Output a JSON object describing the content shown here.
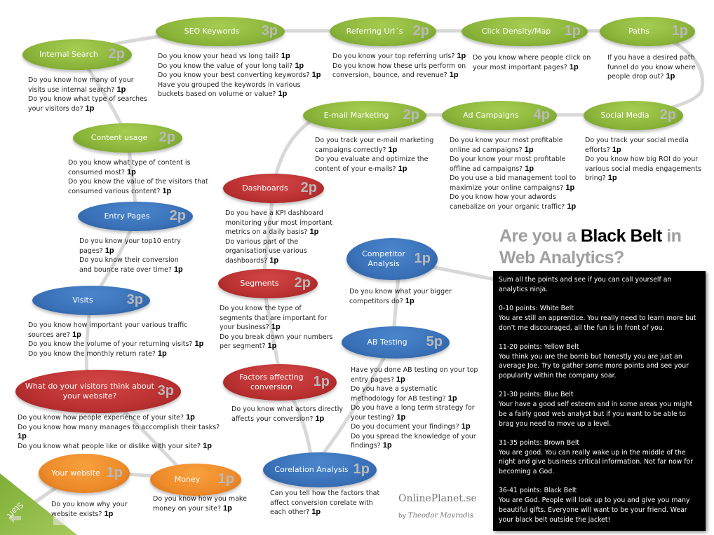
{
  "title": {
    "pre": "Are you a ",
    "highlight": "Black Belt",
    "post": " in",
    "line2": "Web Analytics?"
  },
  "nodes": [
    {
      "id": "internal-search",
      "label": "Internal Search",
      "points": "2p",
      "color": "green",
      "questions": [
        {
          "text": "Do you know how many of your visits use internal search?",
          "points": "1p"
        },
        {
          "text": "Do you know what type of searches your visitors do?",
          "points": "1p"
        }
      ]
    },
    {
      "id": "seo-keywords",
      "label": "SEO Keywords",
      "points": "3p",
      "color": "green",
      "questions": [
        {
          "text": "Do you know your head vs long tail?",
          "points": "1p"
        },
        {
          "text": "Do you know the value of your long tail?",
          "points": "1p"
        },
        {
          "text": "Do you know your best converting keywords?",
          "points": "1p"
        },
        {
          "text": "Have you grouped the keywords in various buckets based on volume or value?",
          "points": "1p"
        }
      ]
    },
    {
      "id": "referring-urls",
      "label": "Referring Url´s",
      "points": "2p",
      "color": "green",
      "questions": [
        {
          "text": "Do you know your top referring urls?",
          "points": "1p"
        },
        {
          "text": "Do you know how these urls perform on conversion, bounce, and revenue?",
          "points": "1p"
        }
      ]
    },
    {
      "id": "click-density",
      "label": "Click Density/Map",
      "points": "1p",
      "color": "green",
      "questions": [
        {
          "text": "Do you know where people click on your most important pages?",
          "points": "1p"
        }
      ]
    },
    {
      "id": "paths",
      "label": "Paths",
      "points": "1p",
      "color": "green",
      "questions": [
        {
          "text": "If you have a desired path funnel do you know where people drop out?",
          "points": "1p"
        }
      ]
    },
    {
      "id": "email-marketing",
      "label": "E-mail Marketing",
      "points": "2p",
      "color": "green",
      "questions": [
        {
          "text": "Do you track your e-mail marketing campaigns correctly?",
          "points": "1p"
        },
        {
          "text": "Do you evaluate and optimize the content of your e-mails?",
          "points": "1p"
        }
      ]
    },
    {
      "id": "ad-campaigns",
      "label": "Ad Campaigns",
      "points": "4p",
      "color": "green",
      "questions": [
        {
          "text": "Do you know your most profitable online ad campaigns?",
          "points": "1p"
        },
        {
          "text": "Do your know your most profitable offline ad campaigns?",
          "points": "1p"
        },
        {
          "text": "Do  you use a bid management tool to maximize your online campaigns?",
          "points": "1p"
        },
        {
          "text": "Do you know how your adwords canebalize on your organic traffic?",
          "points": "1p"
        }
      ]
    },
    {
      "id": "social-media",
      "label": "Social Media",
      "points": "2p",
      "color": "green",
      "questions": [
        {
          "text": "Do you track your social media efforts?",
          "points": "1p"
        },
        {
          "text": "Do you know how big ROI do your various social media engagements bring?",
          "points": "1p"
        }
      ]
    },
    {
      "id": "content-usage",
      "label": "Content usage",
      "points": "2p",
      "color": "green",
      "questions": [
        {
          "text": "Do you know what type of content is consumed most?",
          "points": "1p"
        },
        {
          "text": "Do you know the value of the visitors that consumed various content?",
          "points": "1p"
        }
      ]
    },
    {
      "id": "dashboards",
      "label": "Dashboards",
      "points": "2p",
      "color": "red",
      "questions": [
        {
          "text": "Do you have a KPI dashboard monitoring your most important metrics on a daily basis?",
          "points": "1p"
        },
        {
          "text": "Do various part of the organisation use various dashboards?",
          "points": "1p"
        }
      ]
    },
    {
      "id": "entry-pages",
      "label": "Entry Pages",
      "points": "2p",
      "color": "blue",
      "questions": [
        {
          "text": "Do you know your top10 entry pages?",
          "points": "1p"
        },
        {
          "text": "Do you know their conversion and bounce rate over time?",
          "points": "1p"
        }
      ]
    },
    {
      "id": "competitor-analysis",
      "label": "Competitor Analysis",
      "points": "1p",
      "color": "blue",
      "questions": [
        {
          "text": "Do you know what your bigger competitors do?",
          "points": "1p"
        }
      ]
    },
    {
      "id": "segments",
      "label": "Segments",
      "points": "2p",
      "color": "red",
      "questions": [
        {
          "text": "Do you know the type of segments that are important for your business?",
          "points": "1p"
        },
        {
          "text": "Do you break down your numbers per segment?",
          "points": "1p"
        }
      ]
    },
    {
      "id": "visits",
      "label": "Visits",
      "points": "3p",
      "color": "blue",
      "questions": [
        {
          "text": "Do you know how important your various traffic sources are?",
          "points": "1p"
        },
        {
          "text": "Do you know the volume of your returning visits?",
          "points": "1p"
        },
        {
          "text": "Do you know the monthly return rate?",
          "points": "1p"
        }
      ]
    },
    {
      "id": "ab-testing",
      "label": "AB Testing",
      "points": "5p",
      "color": "blue",
      "questions": [
        {
          "text": "Have you done AB testing on your top entry pages?",
          "points": "1p"
        },
        {
          "text": "Do you have a systematic methodology for AB testing?",
          "points": "1p"
        },
        {
          "text": "Do you have a long term strategy for your testing?",
          "points": "1p"
        },
        {
          "text": "Do you document your findings?",
          "points": "1p"
        },
        {
          "text": "Do you spread the knowledge of your findings?",
          "points": "1p"
        }
      ]
    },
    {
      "id": "visitors-think",
      "label": "What do your visitors think about your website?",
      "points": "3p",
      "color": "red",
      "questions": [
        {
          "text": "Do you know  how people experience of your site?",
          "points": "1p"
        },
        {
          "text": "Do you know  how many manages to accomplish their tasks?",
          "points": "1p"
        },
        {
          "text": "Do you know what people like or dislike with your site?",
          "points": "1p"
        }
      ]
    },
    {
      "id": "factors-affecting",
      "label": "Factors affecting conversion",
      "points": "1p",
      "color": "red",
      "questions": [
        {
          "text": "Do you know what actors directly affects your conversion?",
          "points": "1p"
        }
      ]
    },
    {
      "id": "your-website",
      "label": "Your website",
      "points": "1p",
      "color": "orange",
      "questions": [
        {
          "text": "Do you know why your website exists?",
          "points": "1p"
        }
      ]
    },
    {
      "id": "money",
      "label": "Money",
      "points": "1p",
      "color": "orange",
      "questions": [
        {
          "text": "Do you know  how you make money on your site?",
          "points": "1p"
        }
      ]
    },
    {
      "id": "corelation-analysis",
      "label": "Corelation Analysis",
      "points": "1p",
      "color": "blue",
      "questions": [
        {
          "text": "Can you tell how the factors that affect conversion corelate with each other?",
          "points": "1p"
        }
      ]
    }
  ],
  "scoring": {
    "intro": "Sum all the points and see if you can call yourself an analytics ninja.",
    "levels": [
      {
        "range": "0-10 points: White Belt",
        "text": "You are still an apprentice. You really need to learn more but don’t me discouraged, all the fun is in front of you."
      },
      {
        "range": "11-20 points: Yellow Belt",
        "text": "You think you are the bomb but honestly you are just an average Joe.  Try to gather some more points and see your popularity within the company soar."
      },
      {
        "range": "21-30 points: Blue Belt",
        "text": "Your have a good self esteem and in some areas you might be a fairly good web analyst  but if you want to be able to brag you need to move up a level."
      },
      {
        "range": "31-35 points: Brown Belt",
        "text": "You are good.  You can really wake up in the middle of the night and give business critical information.  Not far now for becoming a God."
      },
      {
        "range": "36-41 points: Black Belt",
        "text": "You are God. People will look up to you and give you many beautiful gifts. Everyone will want to be your friend. Wear your black belt outside the jacket!"
      }
    ]
  },
  "brand": {
    "site": "OnlinePlanet.se",
    "by": "by",
    "author": "Theodor Mavrodis"
  },
  "start_label": "Start",
  "colors": {
    "green": "#8bb53a",
    "blue": "#3a71b8",
    "red": "#bb3131",
    "orange": "#ee8b2a",
    "path": "#d4d4d4"
  }
}
